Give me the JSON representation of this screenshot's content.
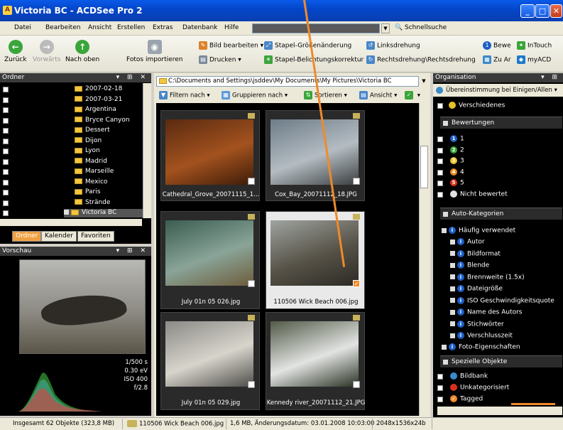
{
  "window": {
    "title": "Victoria BC - ACDSee Pro 2"
  },
  "menu": {
    "items": [
      "Datei",
      "Bearbeiten",
      "Ansicht",
      "Erstellen",
      "Extras",
      "Datenbank",
      "Hilfe"
    ],
    "search_label": "Schnellsuche"
  },
  "toolbar": {
    "back": "Zurück",
    "forward": "Vorwärts",
    "up": "Nach oben",
    "import": "Fotos importieren",
    "edit_image": "Bild bearbeiten",
    "print": "Drucken",
    "batch_resize": "Stapel-Größenänderung",
    "batch_exposure": "Stapel-Belichtungskorrektur",
    "rotate_left": "Linksdrehung",
    "rotate_right": "Rechtsdrehung\\Rechtsdrehung",
    "rate": "Bewe",
    "zu": "Zu Ar",
    "intouch": "InTouch",
    "myacd": "myACD"
  },
  "folders": {
    "header": "Ordner",
    "items": [
      "2007-02-18",
      "2007-03-21",
      "Argentina",
      "Bryce Canyon",
      "Dessert",
      "Dijon",
      "Lyon",
      "Madrid",
      "Marseille",
      "Mexico",
      "Paris",
      "Strände",
      "Victoria BC"
    ],
    "tabs": [
      "Ordner",
      "Kalender",
      "Favoriten"
    ]
  },
  "preview": {
    "header": "Vorschau",
    "exif": [
      "1/500 s",
      "0.30 eV",
      "ISO 400",
      "f/2.8"
    ]
  },
  "browser": {
    "path": "C:\\Documents and Settings\\jsddev\\My Documents\\My Pictures\\Victoria BC",
    "filter": "Filtern nach",
    "group": "Gruppieren nach",
    "sort": "Sortieren",
    "view": "Ansicht",
    "thumbs": [
      {
        "label": "Cathedral_Grove_20071115_1...",
        "colors": [
          "#5a2a10",
          "#a3521e",
          "#3d1b08"
        ]
      },
      {
        "label": "Cox_Bay_20071112_18.JPG",
        "colors": [
          "#6d7c88",
          "#b4bcc2",
          "#3a3f40"
        ]
      },
      {
        "label": "July 01n 05 026.jpg",
        "colors": [
          "#3a5d50",
          "#8aa498",
          "#6c5c3a"
        ]
      },
      {
        "label": "110506 Wick Beach 006.jpg",
        "colors": [
          "#9fa3a0",
          "#565247",
          "#2c2a25"
        ]
      },
      {
        "label": "July 01n 05 029.jpg",
        "colors": [
          "#8b8a86",
          "#d7d4cc",
          "#4e4d48"
        ]
      },
      {
        "label": "Kennedy river_20071112_21.JPG",
        "colors": [
          "#515a48",
          "#e2e4e2",
          "#2a3124"
        ]
      }
    ]
  },
  "organisation": {
    "header": "Organisation",
    "match": "Übereinstimmung bei Einigen/Allen",
    "misc": "Verschiedenes",
    "ratings_header": "Bewertungen",
    "ratings": [
      "1",
      "2",
      "3",
      "4",
      "5",
      "Nicht bewertet"
    ],
    "rating_colors": [
      "#1d5fc8",
      "#3aa53a",
      "#e6c12a",
      "#e68a1e",
      "#d8301e",
      "#e0e0e0"
    ],
    "auto_header": "Auto-Kategorien",
    "frequent": "Häufig verwendet",
    "auto_items": [
      "Autor",
      "Bildformat",
      "Blende",
      "Brennweite (1.5x)",
      "Dateigröße",
      "ISO Geschwindigkeitsquote",
      "Name des Autors",
      "Stichwörter",
      "Verschlusszeit"
    ],
    "photo_props": "Foto-Eigenschaften",
    "special_header": "Spezielle Objekte",
    "special_items": [
      "Bildbank",
      "Unkategorisiert",
      "Tagged"
    ]
  },
  "status": {
    "total": "Insgesamt 62 Objekte (323,8 MB)",
    "file": "110506 Wick Beach 006.jpg",
    "info": "1,6 MB, Änderungsdatum: 03.01.2008 10:03:00",
    "dims": "2048x1536x24b"
  },
  "colors": {
    "accent": "#f08a2a",
    "titlebar": "#0a5ae8"
  }
}
